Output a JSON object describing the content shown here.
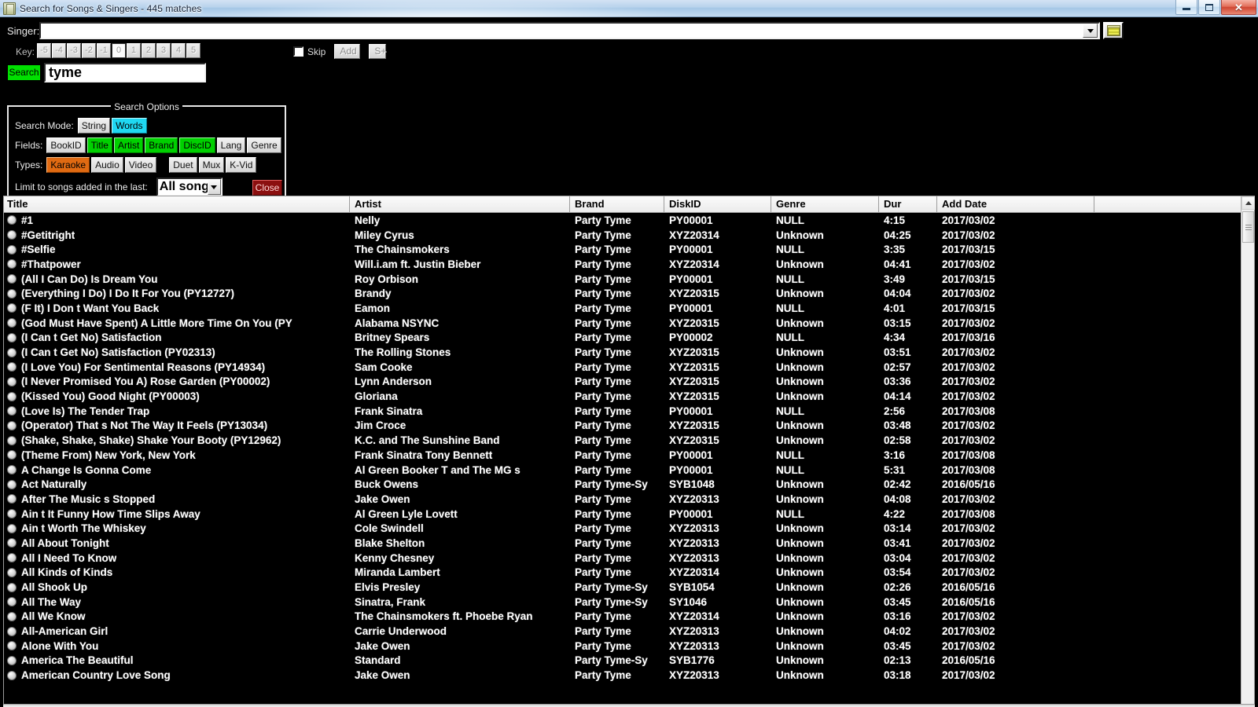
{
  "window": {
    "title": "Search for Songs & Singers - 445 matches",
    "icon": "book-icon",
    "buttons": {
      "minimize": "minimize-icon",
      "maximize": "maximize-icon",
      "close": "close-icon"
    }
  },
  "singer": {
    "label": "Singer:",
    "value": "",
    "placeholder": "",
    "dropdown_icon": "chevron-down-icon",
    "folder_icon": "folder-icon"
  },
  "key": {
    "label": "Key:",
    "values": [
      "-5",
      "-4",
      "-3",
      "-2",
      "-1",
      "0",
      "1",
      "2",
      "3",
      "4",
      "5"
    ],
    "selected": "0"
  },
  "queue": {
    "skip_label": "Skip",
    "skip_checked": false,
    "add_label": "Add",
    "splus_label": "S+"
  },
  "search": {
    "button_label": "Search",
    "value": "tyme",
    "placeholder": ""
  },
  "search_options": {
    "legend": "Search Options",
    "mode_label": "Search Mode:",
    "modes": [
      {
        "label": "String",
        "state": "off"
      },
      {
        "label": "Words",
        "state": "cyan"
      }
    ],
    "fields_label": "Fields:",
    "fields": [
      {
        "label": "BookID",
        "state": "off"
      },
      {
        "label": "Title",
        "state": "green"
      },
      {
        "label": "Artist",
        "state": "green"
      },
      {
        "label": "Brand",
        "state": "green"
      },
      {
        "label": "DiscID",
        "state": "green"
      },
      {
        "label": "Lang",
        "state": "off"
      },
      {
        "label": "Genre",
        "state": "off"
      }
    ],
    "types_label": "Types:",
    "types": [
      {
        "label": "Karaoke",
        "state": "orange"
      },
      {
        "label": "Audio",
        "state": "off"
      },
      {
        "label": "Video",
        "state": "off"
      }
    ],
    "types2": [
      {
        "label": "Duet",
        "state": "off"
      },
      {
        "label": "Mux",
        "state": "off"
      },
      {
        "label": "K-Vid",
        "state": "off"
      }
    ],
    "limit_label": "Limit to songs added in the last:",
    "limit_value": "All songs",
    "limit_dropdown_icon": "chevron-down-icon",
    "close_label": "Close"
  },
  "table": {
    "columns": [
      "Title",
      "Artist",
      "Brand",
      "DiskID",
      "Genre",
      "Dur",
      "Add Date"
    ],
    "rows": [
      {
        "bullet": "disc-icon",
        "title": "#1",
        "artist": "Nelly",
        "brand": "Party Tyme",
        "diskid": "PY00001",
        "genre": "NULL",
        "dur": "4:15",
        "date": "2017/03/02"
      },
      {
        "bullet": "disc-icon",
        "title": "#Getitright",
        "artist": "Miley Cyrus",
        "brand": "Party Tyme",
        "diskid": "XYZ20314",
        "genre": "Unknown",
        "dur": "04:25",
        "date": "2017/03/02"
      },
      {
        "bullet": "disc-icon",
        "title": "#Selfie",
        "artist": "The Chainsmokers",
        "brand": "Party Tyme",
        "diskid": "PY00001",
        "genre": "NULL",
        "dur": "3:35",
        "date": "2017/03/15"
      },
      {
        "bullet": "disc-icon",
        "title": "#Thatpower",
        "artist": "Will.i.am ft. Justin Bieber",
        "brand": "Party Tyme",
        "diskid": "XYZ20314",
        "genre": "Unknown",
        "dur": "04:41",
        "date": "2017/03/02"
      },
      {
        "bullet": "disc-icon",
        "title": "(All I Can Do) Is Dream You",
        "artist": "Roy Orbison",
        "brand": "Party Tyme",
        "diskid": "PY00001",
        "genre": "NULL",
        "dur": "3:49",
        "date": "2017/03/15"
      },
      {
        "bullet": "disc-icon",
        "title": "(Everything I Do) I Do It For You (PY12727)",
        "artist": "Brandy",
        "brand": "Party Tyme",
        "diskid": "XYZ20315",
        "genre": "Unknown",
        "dur": "04:04",
        "date": "2017/03/02"
      },
      {
        "bullet": "disc-icon",
        "title": "(F It) I Don t Want You Back",
        "artist": "Eamon",
        "brand": "Party Tyme",
        "diskid": "PY00001",
        "genre": "NULL",
        "dur": "4:01",
        "date": "2017/03/15"
      },
      {
        "bullet": "disc-icon",
        "title": "(God Must Have Spent) A Little More Time On You (PY",
        "artist": "Alabama   NSYNC",
        "brand": "Party Tyme",
        "diskid": "XYZ20315",
        "genre": "Unknown",
        "dur": "03:15",
        "date": "2017/03/02"
      },
      {
        "bullet": "disc-icon",
        "title": "(I Can t Get No) Satisfaction",
        "artist": "Britney Spears",
        "brand": "Party Tyme",
        "diskid": "PY00002",
        "genre": "NULL",
        "dur": "4:34",
        "date": "2017/03/16"
      },
      {
        "bullet": "disc-icon",
        "title": "(I Can t Get No) Satisfaction (PY02313)",
        "artist": "The Rolling Stones",
        "brand": "Party Tyme",
        "diskid": "XYZ20315",
        "genre": "Unknown",
        "dur": "03:51",
        "date": "2017/03/02"
      },
      {
        "bullet": "disc-icon",
        "title": "(I Love You) For Sentimental Reasons (PY14934)",
        "artist": "Sam Cooke",
        "brand": "Party Tyme",
        "diskid": "XYZ20315",
        "genre": "Unknown",
        "dur": "02:57",
        "date": "2017/03/02"
      },
      {
        "bullet": "disc-icon",
        "title": "(I Never Promised You A) Rose Garden (PY00002)",
        "artist": "Lynn Anderson",
        "brand": "Party Tyme",
        "diskid": "XYZ20315",
        "genre": "Unknown",
        "dur": "03:36",
        "date": "2017/03/02"
      },
      {
        "bullet": "disc-icon",
        "title": "(Kissed You) Good Night (PY00003)",
        "artist": "Gloriana",
        "brand": "Party Tyme",
        "diskid": "XYZ20315",
        "genre": "Unknown",
        "dur": "04:14",
        "date": "2017/03/02"
      },
      {
        "bullet": "disc-icon",
        "title": "(Love Is) The Tender Trap",
        "artist": "Frank Sinatra",
        "brand": "Party Tyme",
        "diskid": "PY00001",
        "genre": "NULL",
        "dur": "2:56",
        "date": "2017/03/08"
      },
      {
        "bullet": "disc-icon",
        "title": "(Operator) That s Not The Way It Feels (PY13034)",
        "artist": "Jim Croce",
        "brand": "Party Tyme",
        "diskid": "XYZ20315",
        "genre": "Unknown",
        "dur": "03:48",
        "date": "2017/03/02"
      },
      {
        "bullet": "disc-icon",
        "title": "(Shake, Shake, Shake) Shake Your Booty (PY12962)",
        "artist": "K.C. and The Sunshine Band",
        "brand": "Party Tyme",
        "diskid": "XYZ20315",
        "genre": "Unknown",
        "dur": "02:58",
        "date": "2017/03/02"
      },
      {
        "bullet": "disc-icon",
        "title": "(Theme From) New York, New York",
        "artist": "Frank Sinatra   Tony Bennett",
        "brand": "Party Tyme",
        "diskid": "PY00001",
        "genre": "NULL",
        "dur": "3:16",
        "date": "2017/03/08"
      },
      {
        "bullet": "disc-icon",
        "title": "A Change Is Gonna Come",
        "artist": "Al Green   Booker T and The MG s",
        "brand": "Party Tyme",
        "diskid": "PY00001",
        "genre": "NULL",
        "dur": "5:31",
        "date": "2017/03/08"
      },
      {
        "bullet": "disc-icon",
        "title": "Act Naturally",
        "artist": "Buck Owens",
        "brand": "Party Tyme-Sy",
        "diskid": "SYB1048",
        "genre": "Unknown",
        "dur": "02:42",
        "date": "2016/05/16"
      },
      {
        "bullet": "disc-icon",
        "title": "After The Music s Stopped",
        "artist": "Jake Owen",
        "brand": "Party Tyme",
        "diskid": "XYZ20313",
        "genre": "Unknown",
        "dur": "04:08",
        "date": "2017/03/02"
      },
      {
        "bullet": "disc-icon",
        "title": "Ain t It Funny How Time Slips Away",
        "artist": "Al Green   Lyle Lovett",
        "brand": "Party Tyme",
        "diskid": "PY00001",
        "genre": "NULL",
        "dur": "4:22",
        "date": "2017/03/08"
      },
      {
        "bullet": "disc-icon",
        "title": "Ain t Worth The Whiskey",
        "artist": "Cole Swindell",
        "brand": "Party Tyme",
        "diskid": "XYZ20313",
        "genre": "Unknown",
        "dur": "03:14",
        "date": "2017/03/02"
      },
      {
        "bullet": "disc-icon",
        "title": "All About Tonight",
        "artist": "Blake Shelton",
        "brand": "Party Tyme",
        "diskid": "XYZ20313",
        "genre": "Unknown",
        "dur": "03:41",
        "date": "2017/03/02"
      },
      {
        "bullet": "disc-icon",
        "title": "All I Need To Know",
        "artist": "Kenny Chesney",
        "brand": "Party Tyme",
        "diskid": "XYZ20313",
        "genre": "Unknown",
        "dur": "03:04",
        "date": "2017/03/02"
      },
      {
        "bullet": "disc-icon",
        "title": "All Kinds of Kinds",
        "artist": "Miranda Lambert",
        "brand": "Party Tyme",
        "diskid": "XYZ20314",
        "genre": "Unknown",
        "dur": "03:54",
        "date": "2017/03/02"
      },
      {
        "bullet": "disc-icon",
        "title": "All Shook Up",
        "artist": "Elvis Presley",
        "brand": "Party Tyme-Sy",
        "diskid": "SYB1054",
        "genre": "Unknown",
        "dur": "02:26",
        "date": "2016/05/16"
      },
      {
        "bullet": "disc-icon",
        "title": "All The Way",
        "artist": "Sinatra, Frank",
        "brand": "Party Tyme-Sy",
        "diskid": "SY1046",
        "genre": "Unknown",
        "dur": "03:45",
        "date": "2016/05/16"
      },
      {
        "bullet": "disc-icon",
        "title": "All We Know",
        "artist": "The Chainsmokers ft. Phoebe Ryan",
        "brand": "Party Tyme",
        "diskid": "XYZ20314",
        "genre": "Unknown",
        "dur": "03:16",
        "date": "2017/03/02"
      },
      {
        "bullet": "disc-icon",
        "title": "All-American Girl",
        "artist": "Carrie Underwood",
        "brand": "Party Tyme",
        "diskid": "XYZ20313",
        "genre": "Unknown",
        "dur": "04:02",
        "date": "2017/03/02"
      },
      {
        "bullet": "disc-icon",
        "title": "Alone With You",
        "artist": "Jake Owen",
        "brand": "Party Tyme",
        "diskid": "XYZ20313",
        "genre": "Unknown",
        "dur": "03:45",
        "date": "2017/03/02"
      },
      {
        "bullet": "disc-icon",
        "title": "America The Beautiful",
        "artist": "Standard",
        "brand": "Party Tyme-Sy",
        "diskid": "SYB1776",
        "genre": "Unknown",
        "dur": "02:13",
        "date": "2016/05/16"
      },
      {
        "bullet": "disc-icon",
        "title": "American Country Love Song",
        "artist": "Jake Owen",
        "brand": "Party Tyme",
        "diskid": "XYZ20313",
        "genre": "Unknown",
        "dur": "03:18",
        "date": "2017/03/02"
      }
    ]
  },
  "scrollbar": {
    "up_icon": "triangle-up-icon",
    "down_icon": "triangle-down-icon",
    "thumb": "scroll-thumb"
  },
  "colors": {
    "accent_green": "#00d000",
    "accent_cyan": "#1fd8f2",
    "accent_orange": "#e06a12",
    "close_red": "#8b0f0f",
    "list_bg": "#000000"
  }
}
